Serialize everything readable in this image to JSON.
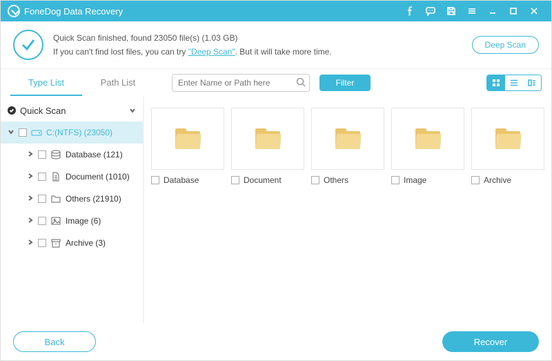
{
  "app": {
    "title": "FoneDog Data Recovery"
  },
  "status": {
    "line1a": "Quick Scan finished, found ",
    "file_count": "23050",
    "line1b": " file(s) ",
    "size": "(1.03 GB)",
    "line2a": "If you can't find lost files, you can try ",
    "deep_link": "\"Deep Scan\"",
    "line2b": ". But it will take more time.",
    "deep_btn": "Deep Scan"
  },
  "tabs": {
    "type": "Type List",
    "path": "Path List"
  },
  "search": {
    "placeholder": "Enter Name or Path here"
  },
  "filter_btn": "Filter",
  "sidebar": {
    "root": "Quick Scan",
    "drive": "C:(NTFS) (23050)",
    "children": [
      {
        "label": "Database (121)"
      },
      {
        "label": "Document (1010)"
      },
      {
        "label": "Others (21910)"
      },
      {
        "label": "Image (6)"
      },
      {
        "label": "Archive (3)"
      }
    ]
  },
  "folders": [
    {
      "label": "Database"
    },
    {
      "label": "Document"
    },
    {
      "label": "Others"
    },
    {
      "label": "Image"
    },
    {
      "label": "Archive"
    }
  ],
  "footer": {
    "back": "Back",
    "recover": "Recover"
  }
}
